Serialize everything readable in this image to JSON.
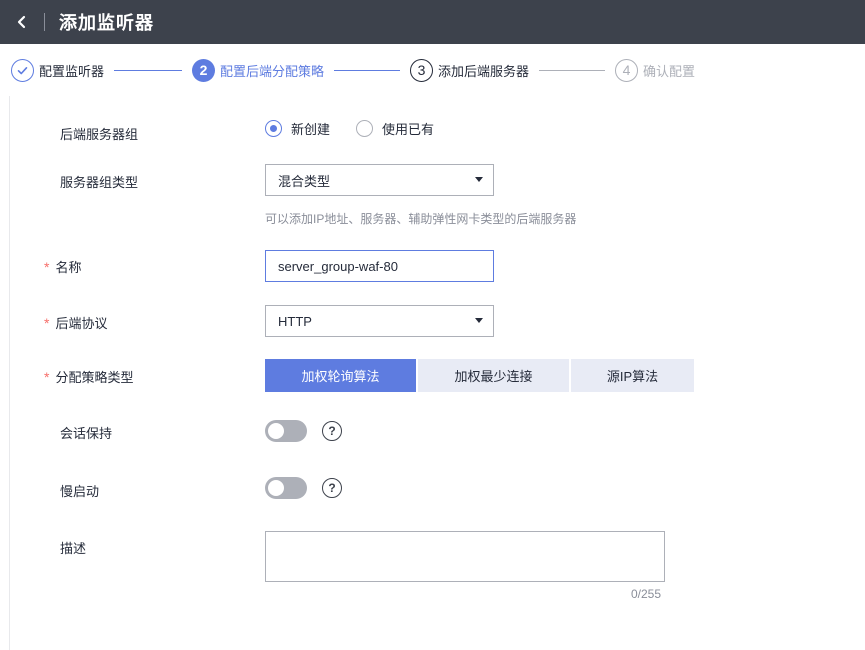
{
  "header": {
    "title": "添加监听器",
    "back_icon": "chevron-left-icon"
  },
  "steps": [
    {
      "label": "配置监听器",
      "state": "done",
      "marker": ""
    },
    {
      "label": "配置后端分配策略",
      "state": "active",
      "marker": "2"
    },
    {
      "label": "添加后端服务器",
      "state": "todo",
      "marker": "3"
    },
    {
      "label": "确认配置",
      "state": "disabled",
      "marker": "4"
    }
  ],
  "form": {
    "server_group": {
      "label": "后端服务器组",
      "options": [
        {
          "label": "新创建",
          "checked": true
        },
        {
          "label": "使用已有",
          "checked": false
        }
      ]
    },
    "group_type": {
      "label": "服务器组类型",
      "value": "混合类型",
      "hint": "可以添加IP地址、服务器、辅助弹性网卡类型的后端服务器"
    },
    "name": {
      "label": "名称",
      "required_mark": "*",
      "value": "server_group-waf-80"
    },
    "protocol": {
      "label": "后端协议",
      "required_mark": "*",
      "value": "HTTP"
    },
    "strategy": {
      "label": "分配策略类型",
      "required_mark": "*",
      "options": [
        {
          "label": "加权轮询算法",
          "active": true
        },
        {
          "label": "加权最少连接",
          "active": false
        },
        {
          "label": "源IP算法",
          "active": false
        }
      ]
    },
    "session": {
      "label": "会话保持",
      "enabled": false,
      "help": "?"
    },
    "slow_start": {
      "label": "慢启动",
      "enabled": false,
      "help": "?"
    },
    "description": {
      "label": "描述",
      "value": "",
      "counter": "0/255"
    }
  },
  "colors": {
    "primary": "#5e7ce0",
    "header_bg": "#3d424c",
    "required": "#f66f6a",
    "segment_inactive": "#e8ebf5",
    "toggle_off": "#adb0b8"
  }
}
